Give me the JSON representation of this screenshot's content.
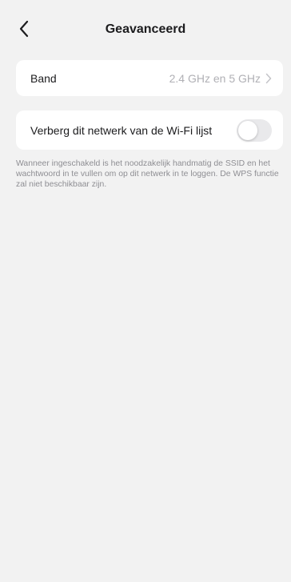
{
  "header": {
    "title": "Geavanceerd",
    "back_icon": "chevron-left-icon"
  },
  "band": {
    "label": "Band",
    "value": "2.4 GHz en 5 GHz",
    "chevron_icon": "chevron-right-icon"
  },
  "hide_network": {
    "label": "Verberg dit netwerk van de Wi-Fi lijst",
    "enabled": false,
    "description": "Wanneer ingeschakeld is het noodzakelijk handmatig de SSID en het wachtwoord in te vullen om op dit netwerk in te loggen. De WPS functie zal niet beschikbaar zijn."
  },
  "colors": {
    "background": "#f2f2f2",
    "card": "#ffffff",
    "secondary_text": "#8e8e93",
    "toggle_off": "#e9e9eb"
  }
}
